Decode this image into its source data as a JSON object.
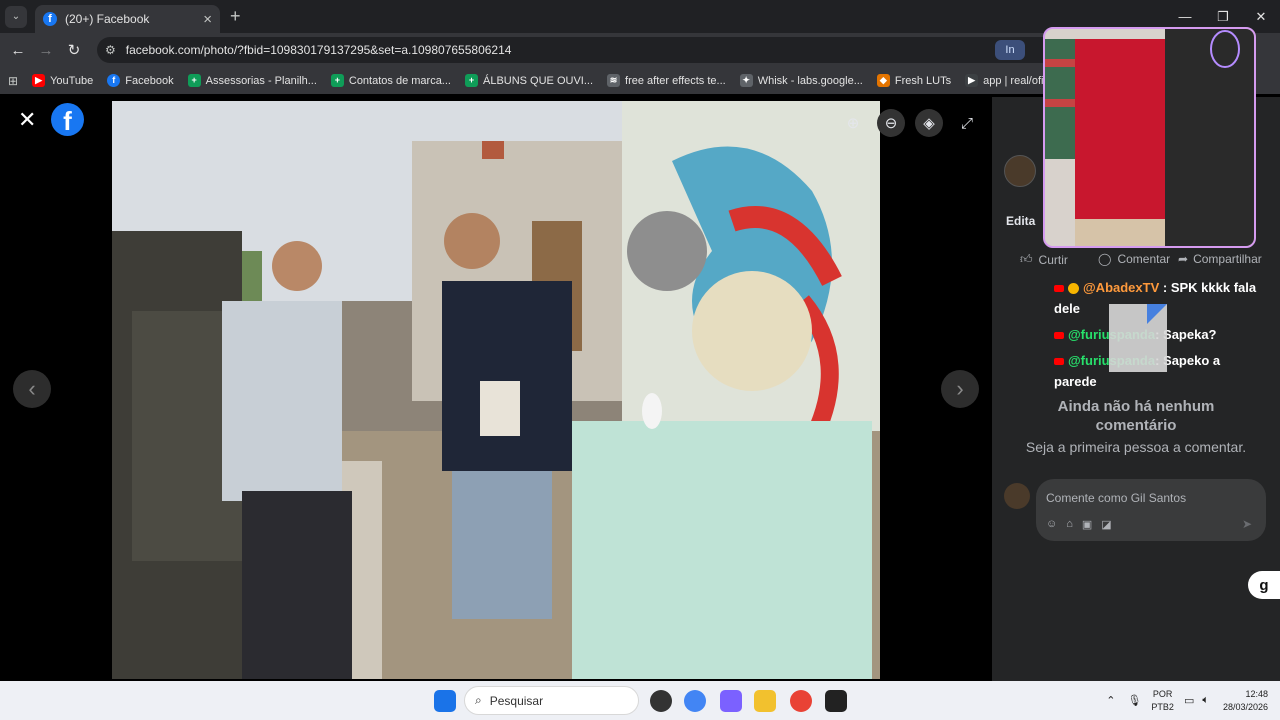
{
  "browser": {
    "tab_title": "(20+) Facebook",
    "url": "facebook.com/photo/?fbid=109830179137295&set=a.109807655806214",
    "bookmarks": [
      {
        "label": "YouTube",
        "icon": "youtube-icon",
        "color": "#ff0000"
      },
      {
        "label": "Facebook",
        "icon": "facebook-icon",
        "color": "#1877f2"
      },
      {
        "label": "Assessorias - Planilh...",
        "icon": "sheets-icon",
        "color": "#0f9d58"
      },
      {
        "label": "Contatos de marca...",
        "icon": "sheets-icon",
        "color": "#0f9d58"
      },
      {
        "label": "ÁLBUNS QUE OUVI...",
        "icon": "sheets-icon",
        "color": "#0f9d58"
      },
      {
        "label": "free after effects te...",
        "icon": "link-icon",
        "color": "#9aa0a6"
      },
      {
        "label": "Whisk - labs.google...",
        "icon": "whisk-icon",
        "color": "#9aa0a6"
      },
      {
        "label": "Fresh LUTs",
        "icon": "lut-icon",
        "color": "#e37400"
      },
      {
        "label": "app | real/oficial",
        "icon": "play-icon",
        "color": "#5f6368"
      }
    ],
    "ext_label": "In"
  },
  "panel": {
    "edit_label": "Edita",
    "actions": {
      "like": "Curtir",
      "comment": "Comentar",
      "share": "Compartilhar"
    },
    "chat": [
      {
        "user": "@AbadexTV",
        "text": ": SPK kkkk fala dele"
      },
      {
        "user": "@furiuspanda",
        "text": ": Sapeka?"
      },
      {
        "user": "@furiuspanda",
        "text": ": Sapeko a parede"
      }
    ],
    "empty_title": "Ainda não há nenhum comentário",
    "empty_sub": "Seja a primeira pessoa a comentar.",
    "comment_placeholder": "Comente como Gil Santos",
    "g_button": "g"
  },
  "taskbar": {
    "search_placeholder": "Pesquisar",
    "lang_line1": "POR",
    "lang_line2": "PTB2",
    "time": "12:48",
    "date": "28/03/2026"
  }
}
